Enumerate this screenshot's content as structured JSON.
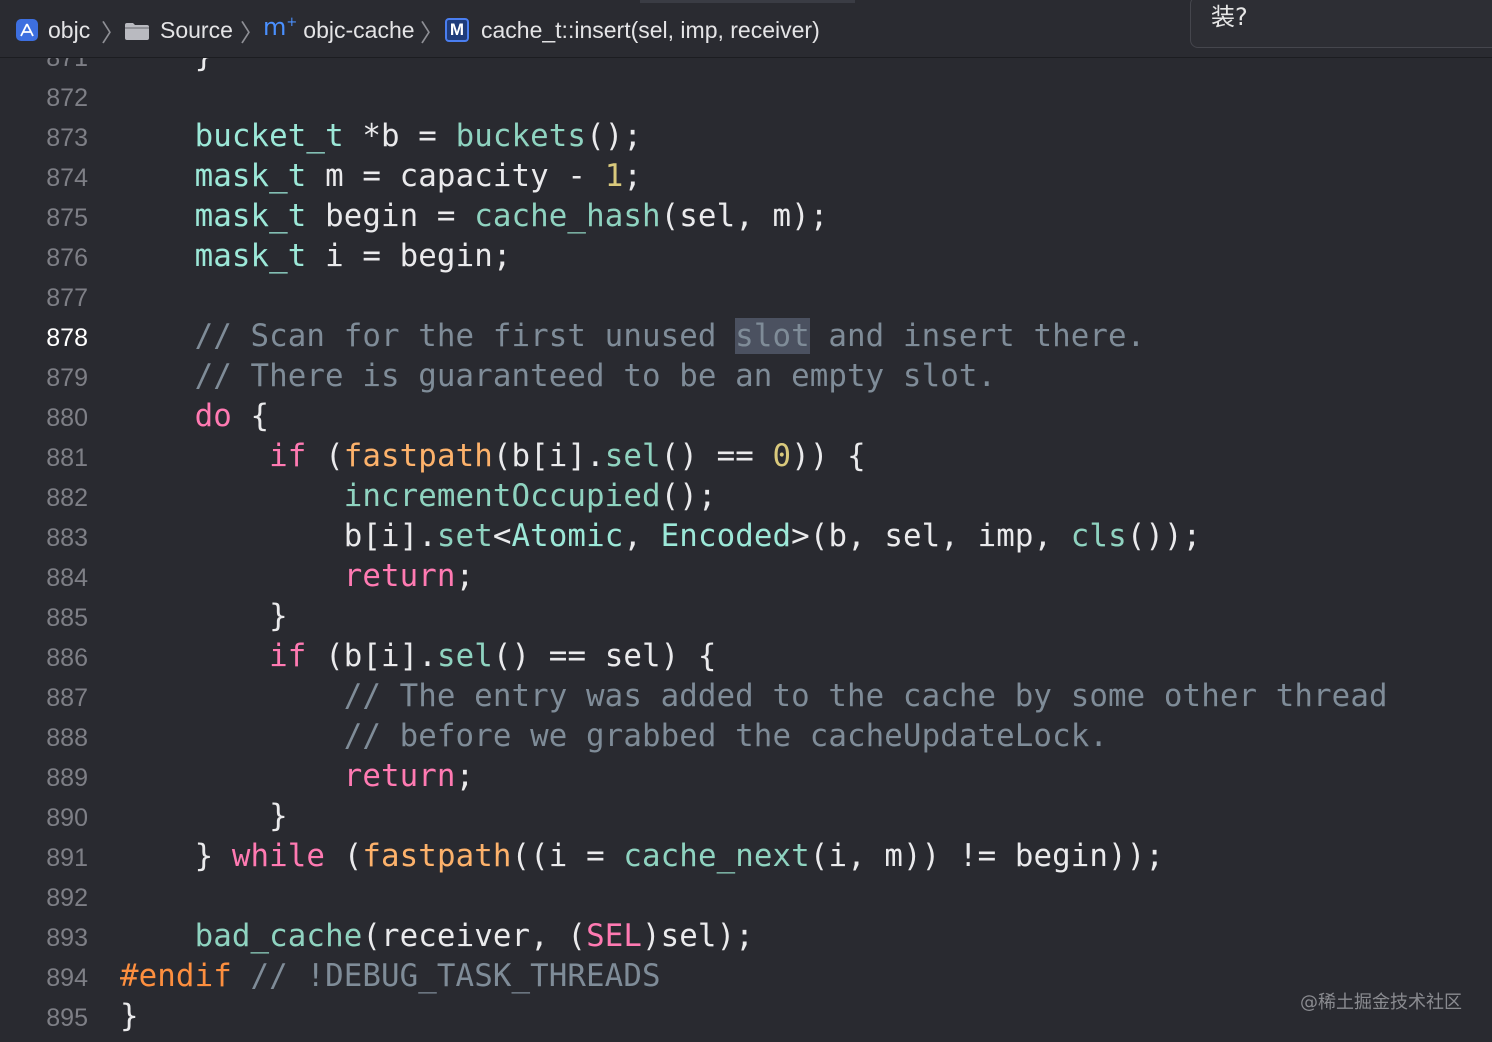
{
  "breadcrumb": {
    "items": [
      {
        "label": "objc",
        "icon": "xcode-project-icon"
      },
      {
        "label": "Source",
        "icon": "folder-icon"
      },
      {
        "label": "objc-cache",
        "icon": "objc-plus-file-icon"
      },
      {
        "label": "cache_t::insert(sel, imp, receiver)",
        "icon": "method-icon"
      }
    ],
    "separator": "〉",
    "icon_glyphs": {
      "mplus": "m",
      "mplus_sup": "+",
      "method": "M"
    }
  },
  "popup": {
    "text": "装?"
  },
  "editor": {
    "current_line": "878",
    "lines": [
      {
        "n": "871",
        "tokens": [
          {
            "t": "    }",
            "c": "plain"
          }
        ]
      },
      {
        "n": "872",
        "tokens": []
      },
      {
        "n": "873",
        "tokens": [
          {
            "t": "    ",
            "c": "plain"
          },
          {
            "t": "bucket_t",
            "c": "type"
          },
          {
            "t": " *b = ",
            "c": "plain"
          },
          {
            "t": "buckets",
            "c": "func"
          },
          {
            "t": "();",
            "c": "plain"
          }
        ]
      },
      {
        "n": "874",
        "tokens": [
          {
            "t": "    ",
            "c": "plain"
          },
          {
            "t": "mask_t",
            "c": "type"
          },
          {
            "t": " m = capacity - ",
            "c": "plain"
          },
          {
            "t": "1",
            "c": "num"
          },
          {
            "t": ";",
            "c": "plain"
          }
        ]
      },
      {
        "n": "875",
        "tokens": [
          {
            "t": "    ",
            "c": "plain"
          },
          {
            "t": "mask_t",
            "c": "type"
          },
          {
            "t": " begin = ",
            "c": "plain"
          },
          {
            "t": "cache_hash",
            "c": "func"
          },
          {
            "t": "(sel, m);",
            "c": "plain"
          }
        ]
      },
      {
        "n": "876",
        "tokens": [
          {
            "t": "    ",
            "c": "plain"
          },
          {
            "t": "mask_t",
            "c": "type"
          },
          {
            "t": " i = begin;",
            "c": "plain"
          }
        ]
      },
      {
        "n": "877",
        "tokens": []
      },
      {
        "n": "878",
        "tokens": [
          {
            "t": "    // Scan for the first unused ",
            "c": "cmt"
          },
          {
            "t": "slot",
            "c": "hl"
          },
          {
            "t": " and insert there.",
            "c": "cmt"
          }
        ]
      },
      {
        "n": "879",
        "tokens": [
          {
            "t": "    // There is guaranteed to be an empty slot.",
            "c": "cmt"
          }
        ]
      },
      {
        "n": "880",
        "tokens": [
          {
            "t": "    ",
            "c": "plain"
          },
          {
            "t": "do",
            "c": "kw"
          },
          {
            "t": " {",
            "c": "plain"
          }
        ]
      },
      {
        "n": "881",
        "tokens": [
          {
            "t": "        ",
            "c": "plain"
          },
          {
            "t": "if",
            "c": "kw"
          },
          {
            "t": " (",
            "c": "plain"
          },
          {
            "t": "fastpath",
            "c": "mac"
          },
          {
            "t": "(b[i].",
            "c": "plain"
          },
          {
            "t": "sel",
            "c": "func"
          },
          {
            "t": "() == ",
            "c": "plain"
          },
          {
            "t": "0",
            "c": "num"
          },
          {
            "t": ")) {",
            "c": "plain"
          }
        ]
      },
      {
        "n": "882",
        "tokens": [
          {
            "t": "            ",
            "c": "plain"
          },
          {
            "t": "incrementOccupied",
            "c": "func"
          },
          {
            "t": "();",
            "c": "plain"
          }
        ]
      },
      {
        "n": "883",
        "tokens": [
          {
            "t": "            b[i].",
            "c": "plain"
          },
          {
            "t": "set",
            "c": "func"
          },
          {
            "t": "<",
            "c": "plain"
          },
          {
            "t": "Atomic",
            "c": "type"
          },
          {
            "t": ", ",
            "c": "plain"
          },
          {
            "t": "Encoded",
            "c": "type"
          },
          {
            "t": ">(b, sel, imp, ",
            "c": "plain"
          },
          {
            "t": "cls",
            "c": "func"
          },
          {
            "t": "());",
            "c": "plain"
          }
        ]
      },
      {
        "n": "884",
        "tokens": [
          {
            "t": "            ",
            "c": "plain"
          },
          {
            "t": "return",
            "c": "kw"
          },
          {
            "t": ";",
            "c": "plain"
          }
        ]
      },
      {
        "n": "885",
        "tokens": [
          {
            "t": "        }",
            "c": "plain"
          }
        ]
      },
      {
        "n": "886",
        "tokens": [
          {
            "t": "        ",
            "c": "plain"
          },
          {
            "t": "if",
            "c": "kw"
          },
          {
            "t": " (b[i].",
            "c": "plain"
          },
          {
            "t": "sel",
            "c": "func"
          },
          {
            "t": "() == sel) {",
            "c": "plain"
          }
        ]
      },
      {
        "n": "887",
        "tokens": [
          {
            "t": "            // The entry was added to the cache by some other thread",
            "c": "cmt"
          }
        ]
      },
      {
        "n": "888",
        "tokens": [
          {
            "t": "            // before we grabbed the cacheUpdateLock.",
            "c": "cmt"
          }
        ]
      },
      {
        "n": "889",
        "tokens": [
          {
            "t": "            ",
            "c": "plain"
          },
          {
            "t": "return",
            "c": "kw"
          },
          {
            "t": ";",
            "c": "plain"
          }
        ]
      },
      {
        "n": "890",
        "tokens": [
          {
            "t": "        }",
            "c": "plain"
          }
        ]
      },
      {
        "n": "891",
        "tokens": [
          {
            "t": "    } ",
            "c": "plain"
          },
          {
            "t": "while",
            "c": "kw"
          },
          {
            "t": " (",
            "c": "plain"
          },
          {
            "t": "fastpath",
            "c": "mac"
          },
          {
            "t": "((i = ",
            "c": "plain"
          },
          {
            "t": "cache_next",
            "c": "func"
          },
          {
            "t": "(i, m)) != begin));",
            "c": "plain"
          }
        ]
      },
      {
        "n": "892",
        "tokens": []
      },
      {
        "n": "893",
        "tokens": [
          {
            "t": "    ",
            "c": "plain"
          },
          {
            "t": "bad_cache",
            "c": "func"
          },
          {
            "t": "(receiver, (",
            "c": "plain"
          },
          {
            "t": "SEL",
            "c": "kw"
          },
          {
            "t": ")sel);",
            "c": "plain"
          }
        ]
      },
      {
        "n": "894",
        "tokens": [
          {
            "t": "#endif",
            "c": "pre"
          },
          {
            "t": " // !DEBUG_TASK_THREADS",
            "c": "cmt"
          }
        ]
      },
      {
        "n": "895",
        "tokens": [
          {
            "t": "}",
            "c": "plain"
          }
        ]
      }
    ]
  },
  "watermark": "@稀土掘金技术社区",
  "colors": {
    "background": "#292a30",
    "plain": "#eaeaec",
    "type": "#9ce8d8",
    "function": "#8fd3c0",
    "keyword": "#ff7ab2",
    "number": "#d9c97c",
    "macro": "#fdb26b",
    "preprocessor": "#fd8f3f",
    "comment": "#7f8c98",
    "line_number": "#7e7f86",
    "search_highlight": "#4b5160"
  }
}
